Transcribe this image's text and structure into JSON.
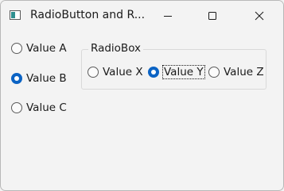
{
  "window": {
    "title": "RadioButton and R..."
  },
  "left_radios": [
    {
      "label": "Value A",
      "checked": false
    },
    {
      "label": "Value B",
      "checked": true
    },
    {
      "label": "Value C",
      "checked": false
    }
  ],
  "radiobox": {
    "label": "RadioBox",
    "options": [
      {
        "label": "Value X",
        "checked": false
      },
      {
        "label": "Value Y",
        "checked": true,
        "focused": true
      },
      {
        "label": "Value Z",
        "checked": false
      }
    ]
  },
  "colors": {
    "accent": "#0b63c4",
    "background": "#f3f3f3"
  }
}
